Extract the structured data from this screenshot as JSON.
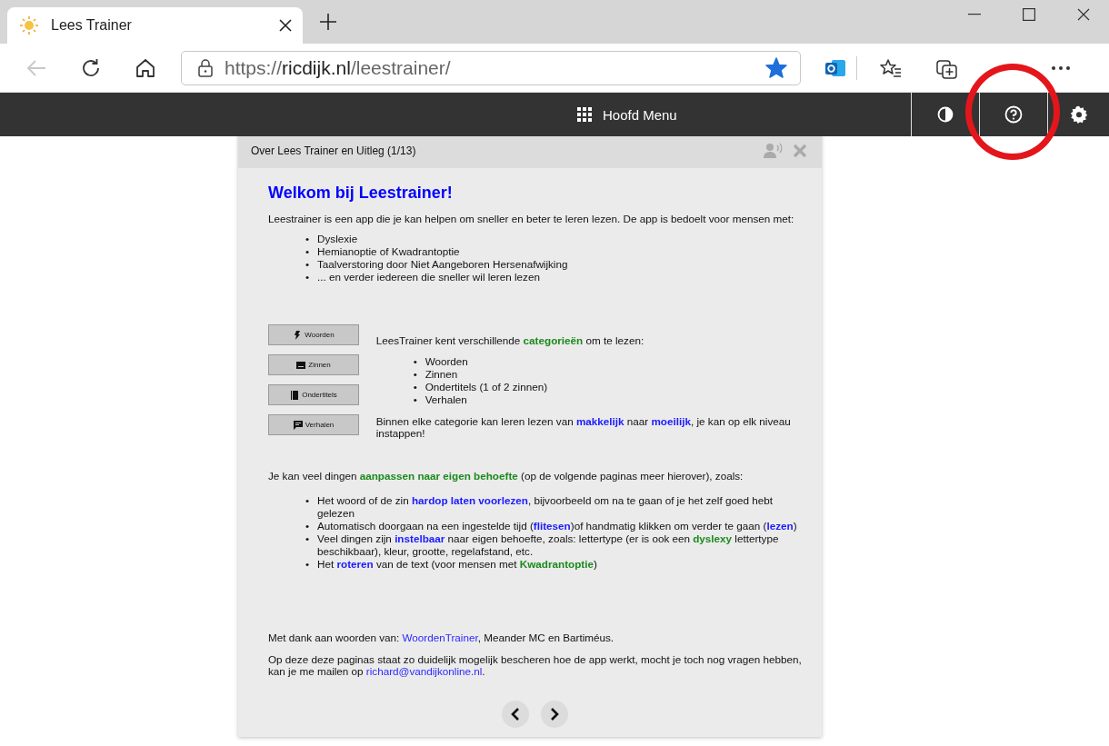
{
  "browser": {
    "tab_title": "Lees Trainer",
    "back_disabled": true,
    "url": {
      "scheme": "https://",
      "host": "ricdijk.nl",
      "path": "/leestrainer/"
    },
    "favorite": true
  },
  "app_bar": {
    "menu_label": "Hoofd Menu"
  },
  "annotation": {
    "color": "#e3161b"
  },
  "dialog": {
    "title": "Over Lees Trainer en Uitleg (1/13)",
    "heading": "Welkom bij Leestrainer!",
    "intro": [
      {
        "t": "Leestrainer is een app die je kan helpen om sneller en beter te leren lezen. De app is bedoelt voor mensen met:",
        "kind": "plain"
      }
    ],
    "audience": [
      "Dyslexie",
      "Hemianoptie of Kwadrantoptie",
      "Taalverstoring door Niet Aangeboren Hersenafwijking",
      "... en verder iedereen die sneller wil leren lezen"
    ],
    "bullet": "•",
    "category_buttons": [
      {
        "label": "Woorden"
      },
      {
        "label": "Zinnen"
      },
      {
        "label": "Ondertitels"
      },
      {
        "label": "Verhalen"
      }
    ],
    "categories_intro": [
      {
        "t": "LeesTrainer kent verschillende ",
        "kind": "plain"
      },
      {
        "t": "categorieën",
        "kind": "green"
      },
      {
        "t": " om te lezen:",
        "kind": "plain"
      }
    ],
    "categories": [
      "Woorden",
      "Zinnen",
      "Ondertitels (1 of 2 zinnen)",
      "Verhalen"
    ],
    "levels": [
      {
        "t": "Binnen elke categorie kan leren lezen van ",
        "kind": "plain"
      },
      {
        "t": "makkelijk",
        "kind": "blue"
      },
      {
        "t": " naar ",
        "kind": "plain"
      },
      {
        "t": "moeilijk",
        "kind": "blue"
      },
      {
        "t": ", je kan op elk niveau instappen!",
        "kind": "plain"
      }
    ],
    "options_intro": [
      {
        "t": "Je kan veel dingen ",
        "kind": "plain"
      },
      {
        "t": "aanpassen naar eigen behoefte",
        "kind": "green"
      },
      {
        "t": " (op de volgende paginas meer hierover), zoals:",
        "kind": "plain"
      }
    ],
    "options": [
      [
        {
          "t": "Het woord of de zin ",
          "kind": "plain"
        },
        {
          "t": "hardop laten voorlezen",
          "kind": "blue"
        },
        {
          "t": ", bijvoorbeeld om na te gaan of je het zelf goed hebt gelezen",
          "kind": "plain"
        }
      ],
      [
        {
          "t": "Automatisch doorgaan na een ingestelde tijd (",
          "kind": "plain"
        },
        {
          "t": "flitesen",
          "kind": "blue"
        },
        {
          "t": ")of handmatig klikken om verder te gaan (",
          "kind": "plain"
        },
        {
          "t": "lezen",
          "kind": "blue"
        },
        {
          "t": ")",
          "kind": "plain"
        }
      ],
      [
        {
          "t": "Veel dingen zijn ",
          "kind": "plain"
        },
        {
          "t": "instelbaar",
          "kind": "blue"
        },
        {
          "t": " naar eigen behoefte, zoals: lettertype (er is ook een ",
          "kind": "plain"
        },
        {
          "t": "dyslexy",
          "kind": "green"
        },
        {
          "t": " lettertype beschikbaar), kleur, grootte, regelafstand, etc.",
          "kind": "plain"
        }
      ],
      [
        {
          "t": "Het ",
          "kind": "plain"
        },
        {
          "t": "roteren",
          "kind": "blue"
        },
        {
          "t": " van de text (voor mensen met ",
          "kind": "plain"
        },
        {
          "t": "Kwadrantoptie",
          "kind": "green"
        },
        {
          "t": ")",
          "kind": "plain"
        }
      ]
    ],
    "credits": [
      {
        "t": "Met dank aan woorden van: ",
        "kind": "plain"
      },
      {
        "t": "WoordenTrainer",
        "kind": "link"
      },
      {
        "t": ", Meander MC en Bartiméus.",
        "kind": "plain"
      }
    ],
    "contact": [
      {
        "t": "Op deze deze paginas staat zo duidelijk mogelijk bescheren hoe de app werkt, mocht je toch nog vragen hebben, kan je me mailen op ",
        "kind": "plain"
      },
      {
        "t": "richard@vandijkonline.nl",
        "kind": "link"
      },
      {
        "t": ".",
        "kind": "plain"
      }
    ]
  }
}
